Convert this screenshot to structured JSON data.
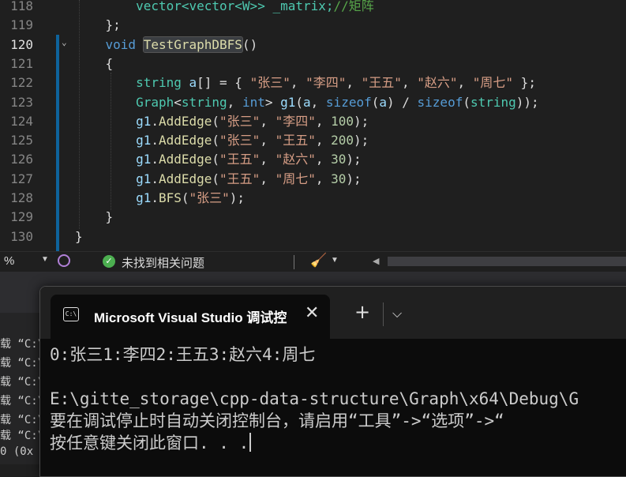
{
  "editor": {
    "lines": [
      {
        "num": "118",
        "tokens": [
          {
            "t": "        vector<vector<W>> _matrix;",
            "c": "ty"
          },
          {
            "t": "//矩阵",
            "c": "cm"
          }
        ]
      },
      {
        "num": "119",
        "tokens": [
          {
            "t": "    };",
            "c": ""
          }
        ]
      },
      {
        "num": "120",
        "tokens": [
          {
            "t": "    ",
            "c": ""
          },
          {
            "t": "void",
            "c": "kw"
          },
          {
            "t": " ",
            "c": ""
          },
          {
            "t": "TestGraphDBFS",
            "c": "fn hl"
          },
          {
            "t": "()",
            "c": ""
          }
        ]
      },
      {
        "num": "121",
        "tokens": [
          {
            "t": "    {",
            "c": ""
          }
        ]
      },
      {
        "num": "122",
        "tokens": [
          {
            "t": "        ",
            "c": ""
          },
          {
            "t": "string",
            "c": "ty"
          },
          {
            "t": " ",
            "c": ""
          },
          {
            "t": "a",
            "c": "vr"
          },
          {
            "t": "[] = { ",
            "c": ""
          },
          {
            "t": "\"张三\"",
            "c": "st"
          },
          {
            "t": ", ",
            "c": ""
          },
          {
            "t": "\"李四\"",
            "c": "st"
          },
          {
            "t": ", ",
            "c": ""
          },
          {
            "t": "\"王五\"",
            "c": "st"
          },
          {
            "t": ", ",
            "c": ""
          },
          {
            "t": "\"赵六\"",
            "c": "st"
          },
          {
            "t": ", ",
            "c": ""
          },
          {
            "t": "\"周七\"",
            "c": "st"
          },
          {
            "t": " };",
            "c": ""
          }
        ]
      },
      {
        "num": "123",
        "tokens": [
          {
            "t": "        ",
            "c": ""
          },
          {
            "t": "Graph",
            "c": "ty"
          },
          {
            "t": "<",
            "c": ""
          },
          {
            "t": "string",
            "c": "ty"
          },
          {
            "t": ", ",
            "c": ""
          },
          {
            "t": "int",
            "c": "kw"
          },
          {
            "t": "> ",
            "c": ""
          },
          {
            "t": "g1",
            "c": "vr"
          },
          {
            "t": "(",
            "c": ""
          },
          {
            "t": "a",
            "c": "vr"
          },
          {
            "t": ", ",
            "c": ""
          },
          {
            "t": "sizeof",
            "c": "kw"
          },
          {
            "t": "(",
            "c": ""
          },
          {
            "t": "a",
            "c": "vr"
          },
          {
            "t": ") / ",
            "c": ""
          },
          {
            "t": "sizeof",
            "c": "kw"
          },
          {
            "t": "(",
            "c": ""
          },
          {
            "t": "string",
            "c": "ty"
          },
          {
            "t": "));",
            "c": ""
          }
        ]
      },
      {
        "num": "124",
        "tokens": [
          {
            "t": "        ",
            "c": ""
          },
          {
            "t": "g1",
            "c": "vr"
          },
          {
            "t": ".",
            "c": ""
          },
          {
            "t": "AddEdge",
            "c": "fn"
          },
          {
            "t": "(",
            "c": ""
          },
          {
            "t": "\"张三\"",
            "c": "st"
          },
          {
            "t": ", ",
            "c": ""
          },
          {
            "t": "\"李四\"",
            "c": "st"
          },
          {
            "t": ", ",
            "c": ""
          },
          {
            "t": "100",
            "c": "nm"
          },
          {
            "t": ");",
            "c": ""
          }
        ]
      },
      {
        "num": "125",
        "tokens": [
          {
            "t": "        ",
            "c": ""
          },
          {
            "t": "g1",
            "c": "vr"
          },
          {
            "t": ".",
            "c": ""
          },
          {
            "t": "AddEdge",
            "c": "fn"
          },
          {
            "t": "(",
            "c": ""
          },
          {
            "t": "\"张三\"",
            "c": "st"
          },
          {
            "t": ", ",
            "c": ""
          },
          {
            "t": "\"王五\"",
            "c": "st"
          },
          {
            "t": ", ",
            "c": ""
          },
          {
            "t": "200",
            "c": "nm"
          },
          {
            "t": ");",
            "c": ""
          }
        ]
      },
      {
        "num": "126",
        "tokens": [
          {
            "t": "        ",
            "c": ""
          },
          {
            "t": "g1",
            "c": "vr"
          },
          {
            "t": ".",
            "c": ""
          },
          {
            "t": "AddEdge",
            "c": "fn"
          },
          {
            "t": "(",
            "c": ""
          },
          {
            "t": "\"王五\"",
            "c": "st"
          },
          {
            "t": ", ",
            "c": ""
          },
          {
            "t": "\"赵六\"",
            "c": "st"
          },
          {
            "t": ", ",
            "c": ""
          },
          {
            "t": "30",
            "c": "nm"
          },
          {
            "t": ");",
            "c": ""
          }
        ]
      },
      {
        "num": "127",
        "tokens": [
          {
            "t": "        ",
            "c": ""
          },
          {
            "t": "g1",
            "c": "vr"
          },
          {
            "t": ".",
            "c": ""
          },
          {
            "t": "AddEdge",
            "c": "fn"
          },
          {
            "t": "(",
            "c": ""
          },
          {
            "t": "\"王五\"",
            "c": "st"
          },
          {
            "t": ", ",
            "c": ""
          },
          {
            "t": "\"周七\"",
            "c": "st"
          },
          {
            "t": ", ",
            "c": ""
          },
          {
            "t": "30",
            "c": "nm"
          },
          {
            "t": ");",
            "c": ""
          }
        ]
      },
      {
        "num": "128",
        "tokens": [
          {
            "t": "        ",
            "c": ""
          },
          {
            "t": "g1",
            "c": "vr"
          },
          {
            "t": ".",
            "c": ""
          },
          {
            "t": "BFS",
            "c": "fn"
          },
          {
            "t": "(",
            "c": ""
          },
          {
            "t": "\"张三\"",
            "c": "st"
          },
          {
            "t": ");",
            "c": ""
          }
        ]
      },
      {
        "num": "129",
        "tokens": [
          {
            "t": "    }",
            "c": ""
          }
        ]
      },
      {
        "num": "130",
        "tokens": [
          {
            "t": "}",
            "c": ""
          }
        ]
      }
    ],
    "current_line": "120"
  },
  "status": {
    "zoom": "%",
    "issues": "未找到相关问题"
  },
  "bg_output": {
    "lines": [
      "载 “C:\\",
      "载 “C:\\",
      "载 “C:\\",
      "载 “C:\\",
      "载 “C:\\",
      "载 “C:\\",
      "0 (0x"
    ]
  },
  "console": {
    "tab_title": "Microsoft Visual Studio 调试控",
    "tab_icon_text": "C:\\",
    "new_tab": "+",
    "close": "✕",
    "dropdown": "⌵",
    "output": [
      "0:张三1:李四2:王五3:赵六4:周七",
      "",
      "E:\\gitte_storage\\cpp-data-structure\\Graph\\x64\\Debug\\G",
      "要在调试停止时自动关闭控制台，请启用“工具”->“选项”->“",
      "按任意键关闭此窗口. . ."
    ]
  },
  "colors": {
    "editor_bg": "#1f1f1f",
    "console_bg": "#0c0c0c",
    "change_bar": "#0e639c",
    "keyword": "#569cd6",
    "type": "#4ec9b0",
    "function": "#dcdcaa",
    "string": "#d69d85"
  }
}
